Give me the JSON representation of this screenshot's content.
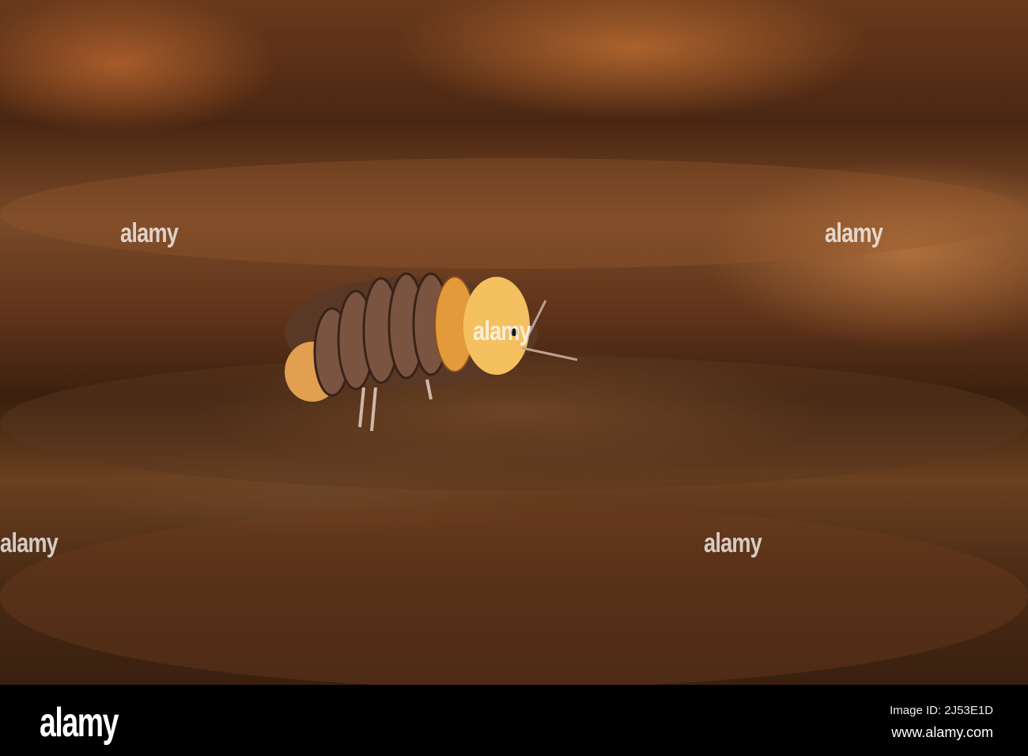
{
  "watermark": {
    "text": "alamy"
  },
  "footer": {
    "logo": "alamy",
    "image_id": "Image ID: 2J53E1D",
    "site": "www.alamy.com"
  }
}
